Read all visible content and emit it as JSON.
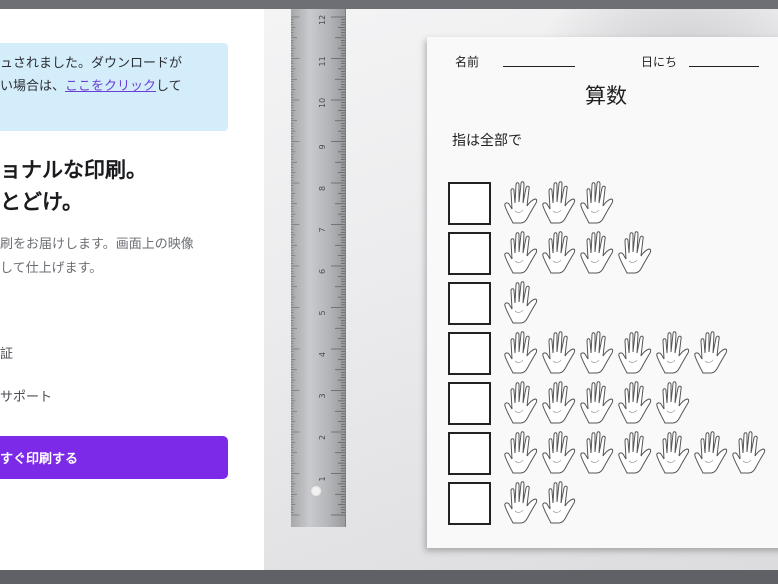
{
  "modal": {
    "notice": {
      "line1": "ュされました。ダウンロードが",
      "line2_prefix": "い場合は、",
      "link": "ここをクリック",
      "line2_suffix": "して"
    },
    "heading": {
      "line1": "ョナルな印刷。",
      "line2": "とどけ。"
    },
    "description": {
      "line1": "刷をお届けします。画面上の映像",
      "line2": "して仕上げます。"
    },
    "features": [
      "証",
      "サポート"
    ],
    "print_button": "すぐ印刷する"
  },
  "worksheet": {
    "name_label": "名前",
    "date_label": "日にち",
    "title": "算数",
    "instruction": "指は全部で",
    "rows": [
      {
        "hands": 3
      },
      {
        "hands": 4
      },
      {
        "hands": 1
      },
      {
        "hands": 6
      },
      {
        "hands": 5
      },
      {
        "hands": 7
      },
      {
        "hands": 2
      }
    ]
  },
  "ruler": {
    "numbers": [
      "12",
      "11",
      "10",
      "9",
      "8",
      "7",
      "6",
      "5",
      "4",
      "3",
      "2",
      "1"
    ]
  },
  "colors": {
    "notice_bg": "#d4edfb",
    "link": "#6a3fd6",
    "button_bg": "#7c2ae8",
    "backdrop": "#8e9096"
  }
}
